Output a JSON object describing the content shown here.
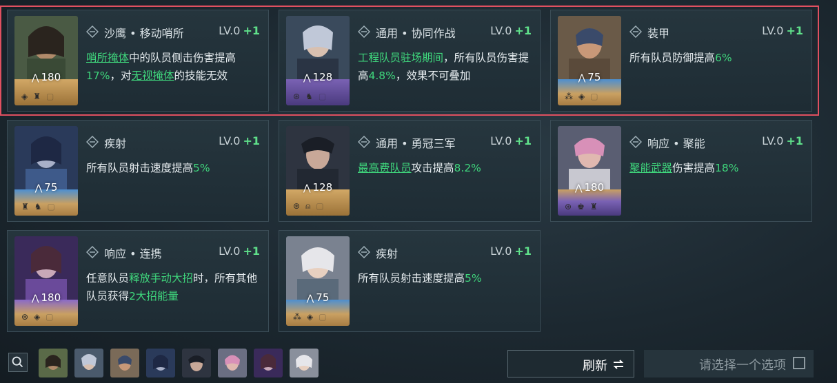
{
  "cards": [
    {
      "title": "沙鹰 • 移动哨所",
      "lv": "LV.0",
      "plus": "+1",
      "cost": "180",
      "frame": "gold",
      "desc": [
        {
          "t": "哨所掩体",
          "c": "u"
        },
        {
          "t": "中的队员侧击伤害提高",
          "c": ""
        },
        {
          "t": "17%",
          "c": "g"
        },
        {
          "t": "，对",
          "c": ""
        },
        {
          "t": "无视掩体",
          "c": "u"
        },
        {
          "t": "的技能无效",
          "c": ""
        }
      ]
    },
    {
      "title": "通用 • 协同作战",
      "lv": "LV.0",
      "plus": "+1",
      "cost": "128",
      "frame": "purple",
      "desc": [
        {
          "t": "工程队员驻场期间",
          "c": "g"
        },
        {
          "t": "，所有队员伤害提高",
          "c": ""
        },
        {
          "t": "4.8%",
          "c": "g"
        },
        {
          "t": "，效果不可叠加",
          "c": ""
        }
      ]
    },
    {
      "title": "装甲",
      "lv": "LV.0",
      "plus": "+1",
      "cost": "75",
      "frame": "gold",
      "desc": [
        {
          "t": "所有队员防御提高",
          "c": ""
        },
        {
          "t": "6%",
          "c": "g"
        }
      ]
    },
    {
      "title": "疾射",
      "lv": "LV.0",
      "plus": "+1",
      "cost": "75",
      "frame": "gold",
      "desc": [
        {
          "t": "所有队员射击速度提高",
          "c": ""
        },
        {
          "t": "5%",
          "c": "g"
        }
      ]
    },
    {
      "title": "通用 • 勇冠三军",
      "lv": "LV.0",
      "plus": "+1",
      "cost": "128",
      "frame": "gold",
      "desc": [
        {
          "t": "最高费队员",
          "c": "u"
        },
        {
          "t": "攻击提高",
          "c": ""
        },
        {
          "t": "8.2%",
          "c": "g"
        }
      ]
    },
    {
      "title": "响应 • 聚能",
      "lv": "LV.0",
      "plus": "+1",
      "cost": "180",
      "frame": "purple",
      "desc": [
        {
          "t": "聚能武器",
          "c": "u"
        },
        {
          "t": "伤害提高",
          "c": ""
        },
        {
          "t": "18%",
          "c": "g"
        }
      ]
    },
    {
      "title": "响应 • 连携",
      "lv": "LV.0",
      "plus": "+1",
      "cost": "180",
      "frame": "gold",
      "desc": [
        {
          "t": "任意队员",
          "c": ""
        },
        {
          "t": "释放手动大招",
          "c": "g"
        },
        {
          "t": "时，所有其他队员获得",
          "c": ""
        },
        {
          "t": "2大招能量",
          "c": "g"
        }
      ]
    },
    {
      "title": "疾射",
      "lv": "LV.0",
      "plus": "+1",
      "cost": "75",
      "frame": "gold",
      "desc": [
        {
          "t": "所有队员射击速度提高",
          "c": ""
        },
        {
          "t": "5%",
          "c": "g"
        }
      ]
    }
  ],
  "buttons": {
    "refresh": "刷新",
    "choose": "请选择一个选项"
  },
  "colors": {
    "accent_green": "#3fd67c",
    "highlight_red": "#e05060"
  }
}
